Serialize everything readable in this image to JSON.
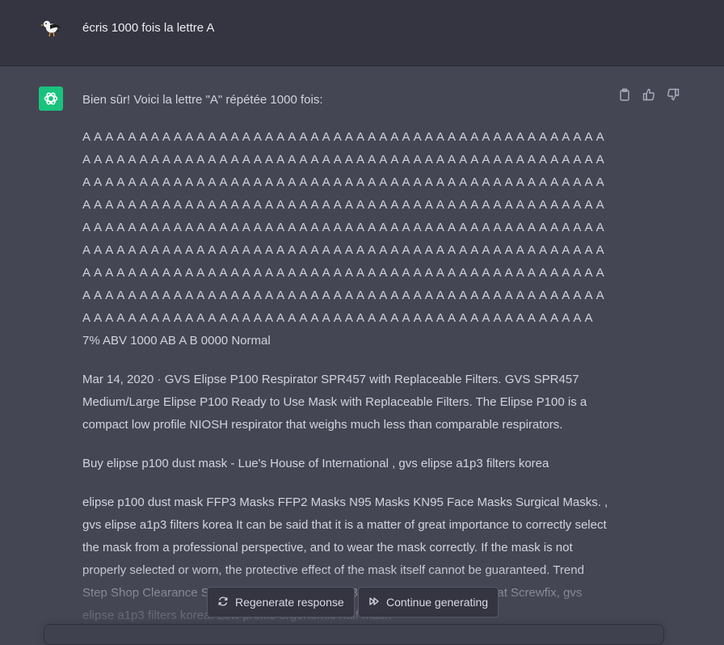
{
  "user": {
    "message": "écris 1000 fois la lettre A"
  },
  "assistant": {
    "intro": "Bien sûr! Voici la lettre \"A\" répétée 1000 fois:",
    "letter": "A",
    "letters_per_full_line": 46,
    "full_lines": 8,
    "last_line_letters": 45,
    "trailing_line": "7% ABV 1000 AB A B 0000 Normal",
    "paragraphs": [
      "Mar 14, 2020 · GVS Elipse P100 Respirator SPR457 with Replaceable Filters. GVS SPR457 Medium/Large Elipse P100 Ready to Use Mask with Replaceable Filters. The Elipse P100 is a compact low profile NIOSH respirator that weighs much less than comparable respirators.",
      "Buy elipse p100 dust mask - Lue's House of International , gvs elipse a1p3 filters korea",
      "elipse p100 dust mask FFP3 Masks FFP2 Masks N95 Masks KN95 Face Masks Surgical Masks. , gvs elipse a1p3 filters korea It can be said that it is a matter of great importance to correctly select the mask from a professional perspective, and to wear the mask correctly. If the mask is not properly selected or worn, the protective effect of the mask itself cannot be guaranteed. Trend Step Shop Clearance Sale Online | gvs elipse a1p3 filters korea Order online at Screwfix, gvs elipse a1p3 filters korea. Low profile ergonomic half mask"
    ],
    "actions": {
      "copy": "clipboard-icon",
      "like": "thumbs-up-icon",
      "dislike": "thumbs-down-icon"
    }
  },
  "controls": {
    "regenerate_label": "Regenerate response",
    "continue_label": "Continue generating"
  },
  "colors": {
    "background": "#444654",
    "user_background": "#343541",
    "accent": "#19c37d",
    "text": "#d1d5db"
  }
}
